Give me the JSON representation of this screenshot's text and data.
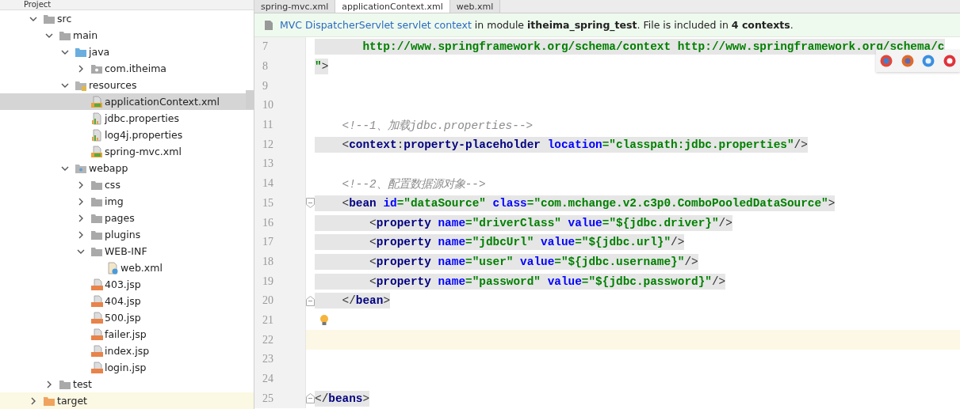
{
  "project_panel": {
    "title": "Project",
    "tree": [
      {
        "label": "src",
        "kind": "folder",
        "expanded": true,
        "selected": false,
        "highlighted": false,
        "children": [
          {
            "label": "main",
            "kind": "folder",
            "expanded": true,
            "selected": false,
            "highlighted": false,
            "children": [
              {
                "label": "java",
                "kind": "source-folder",
                "expanded": true,
                "selected": false,
                "highlighted": false,
                "children": [
                  {
                    "label": "com.itheima",
                    "kind": "package",
                    "expanded": false,
                    "selected": false,
                    "highlighted": false
                  }
                ]
              },
              {
                "label": "resources",
                "kind": "resource-folder",
                "expanded": true,
                "selected": false,
                "highlighted": false,
                "children": [
                  {
                    "label": "applicationContext.xml",
                    "kind": "spring-xml",
                    "selected": true,
                    "highlighted": false
                  },
                  {
                    "label": "jdbc.properties",
                    "kind": "properties",
                    "selected": false,
                    "highlighted": false
                  },
                  {
                    "label": "log4j.properties",
                    "kind": "properties",
                    "selected": false,
                    "highlighted": false
                  },
                  {
                    "label": "spring-mvc.xml",
                    "kind": "spring-xml",
                    "selected": false,
                    "highlighted": false
                  }
                ]
              },
              {
                "label": "webapp",
                "kind": "web-folder",
                "expanded": true,
                "selected": false,
                "highlighted": false,
                "children": [
                  {
                    "label": "css",
                    "kind": "folder",
                    "expanded": false,
                    "selected": false,
                    "highlighted": false
                  },
                  {
                    "label": "img",
                    "kind": "folder",
                    "expanded": false,
                    "selected": false,
                    "highlighted": false
                  },
                  {
                    "label": "pages",
                    "kind": "folder",
                    "expanded": false,
                    "selected": false,
                    "highlighted": false
                  },
                  {
                    "label": "plugins",
                    "kind": "folder",
                    "expanded": false,
                    "selected": false,
                    "highlighted": false
                  },
                  {
                    "label": "WEB-INF",
                    "kind": "folder",
                    "expanded": true,
                    "selected": false,
                    "highlighted": false,
                    "children": [
                      {
                        "label": "web.xml",
                        "kind": "web-xml",
                        "selected": false,
                        "highlighted": false
                      }
                    ]
                  },
                  {
                    "label": "403.jsp",
                    "kind": "jsp",
                    "selected": false,
                    "highlighted": false
                  },
                  {
                    "label": "404.jsp",
                    "kind": "jsp",
                    "selected": false,
                    "highlighted": false
                  },
                  {
                    "label": "500.jsp",
                    "kind": "jsp",
                    "selected": false,
                    "highlighted": false
                  },
                  {
                    "label": "failer.jsp",
                    "kind": "jsp",
                    "selected": false,
                    "highlighted": false
                  },
                  {
                    "label": "index.jsp",
                    "kind": "jsp",
                    "selected": false,
                    "highlighted": false
                  },
                  {
                    "label": "login.jsp",
                    "kind": "jsp",
                    "selected": false,
                    "highlighted": false
                  }
                ]
              }
            ]
          },
          {
            "label": "test",
            "kind": "folder",
            "expanded": false,
            "selected": false,
            "highlighted": false
          }
        ]
      },
      {
        "label": "target",
        "kind": "excluded-folder",
        "expanded": false,
        "selected": false,
        "highlighted": true
      }
    ]
  },
  "editor": {
    "tabs": [
      {
        "label": "spring-mvc.xml",
        "selected": false
      },
      {
        "label": "applicationContext.xml",
        "selected": true
      },
      {
        "label": "web.xml",
        "selected": false
      }
    ],
    "notification": {
      "link": "MVC DispatcherServlet servlet context",
      "text": " in module **itheima_spring_test**. File is included in **4 contexts**."
    },
    "lines": [
      {
        "number": "7",
        "highlighted": true,
        "tokens": [
          {
            "kind": "value",
            "text": "       http://www.springframework.org/schema/context http://www.springframework.org/schema/c"
          }
        ]
      },
      {
        "number": "8",
        "highlighted": true,
        "tokens": [
          {
            "kind": "value",
            "text": "\""
          },
          {
            "kind": "punct",
            "text": ">"
          }
        ]
      },
      {
        "number": "9"
      },
      {
        "number": "10"
      },
      {
        "number": "11",
        "highlighted": false,
        "tokens": [
          {
            "kind": "comment",
            "text": "    <!--1、加载jdbc.properties-->"
          }
        ]
      },
      {
        "number": "12",
        "highlighted": true,
        "tokens": [
          {
            "kind": "punct",
            "text": "    <"
          },
          {
            "kind": "tag",
            "text": "context"
          },
          {
            "kind": "punct",
            "text": ":"
          },
          {
            "kind": "tag",
            "text": "property-placeholder "
          },
          {
            "kind": "attr",
            "text": "location"
          },
          {
            "kind": "value",
            "text": "=\"classpath:jdbc.properties\""
          },
          {
            "kind": "punct",
            "text": "/>"
          }
        ]
      },
      {
        "number": "13"
      },
      {
        "number": "14",
        "highlighted": false,
        "tokens": [
          {
            "kind": "comment",
            "text": "    <!--2、配置数据源对象-->"
          }
        ]
      },
      {
        "number": "15",
        "highlighted": true,
        "fold_start": true,
        "tokens": [
          {
            "kind": "punct",
            "text": "    <"
          },
          {
            "kind": "tag",
            "text": "bean "
          },
          {
            "kind": "attr",
            "text": "id"
          },
          {
            "kind": "value",
            "text": "=\"dataSource\" "
          },
          {
            "kind": "attr",
            "text": "class"
          },
          {
            "kind": "value",
            "text": "=\"com.mchange.v2.c3p0.ComboPooledDataSource\""
          },
          {
            "kind": "punct",
            "text": ">"
          }
        ]
      },
      {
        "number": "16",
        "highlighted": true,
        "tokens": [
          {
            "kind": "punct",
            "text": "        <"
          },
          {
            "kind": "tag",
            "text": "property "
          },
          {
            "kind": "attr",
            "text": "name"
          },
          {
            "kind": "value",
            "text": "=\"driverClass\" "
          },
          {
            "kind": "attr",
            "text": "value"
          },
          {
            "kind": "value",
            "text": "=\"${jdbc.driver}\""
          },
          {
            "kind": "punct",
            "text": "/>"
          }
        ]
      },
      {
        "number": "17",
        "highlighted": true,
        "tokens": [
          {
            "kind": "punct",
            "text": "        <"
          },
          {
            "kind": "tag",
            "text": "property "
          },
          {
            "kind": "attr",
            "text": "name"
          },
          {
            "kind": "value",
            "text": "=\"jdbcUrl\" "
          },
          {
            "kind": "attr",
            "text": "value"
          },
          {
            "kind": "value",
            "text": "=\"${jdbc.url}\""
          },
          {
            "kind": "punct",
            "text": "/>"
          }
        ]
      },
      {
        "number": "18",
        "highlighted": true,
        "tokens": [
          {
            "kind": "punct",
            "text": "        <"
          },
          {
            "kind": "tag",
            "text": "property "
          },
          {
            "kind": "attr",
            "text": "name"
          },
          {
            "kind": "value",
            "text": "=\"user\" "
          },
          {
            "kind": "attr",
            "text": "value"
          },
          {
            "kind": "value",
            "text": "=\"${jdbc.username}\""
          },
          {
            "kind": "punct",
            "text": "/>"
          }
        ]
      },
      {
        "number": "19",
        "highlighted": true,
        "tokens": [
          {
            "kind": "punct",
            "text": "        <"
          },
          {
            "kind": "tag",
            "text": "property "
          },
          {
            "kind": "attr",
            "text": "name"
          },
          {
            "kind": "value",
            "text": "=\"password\" "
          },
          {
            "kind": "attr",
            "text": "value"
          },
          {
            "kind": "value",
            "text": "=\"${jdbc.password}\""
          },
          {
            "kind": "punct",
            "text": "/>"
          }
        ]
      },
      {
        "number": "20",
        "highlighted": true,
        "fold_end": true,
        "tokens": [
          {
            "kind": "punct",
            "text": "    </"
          },
          {
            "kind": "tag",
            "text": "bean"
          },
          {
            "kind": "punct",
            "text": ">"
          }
        ]
      },
      {
        "number": "21",
        "hint": true
      },
      {
        "number": "22",
        "current": true
      },
      {
        "number": "23"
      },
      {
        "number": "24"
      },
      {
        "number": "25",
        "highlighted": true,
        "fold_end": true,
        "tokens": [
          {
            "kind": "punct",
            "text": "</"
          },
          {
            "kind": "tag",
            "text": "beans"
          },
          {
            "kind": "punct",
            "text": ">"
          }
        ]
      }
    ]
  }
}
